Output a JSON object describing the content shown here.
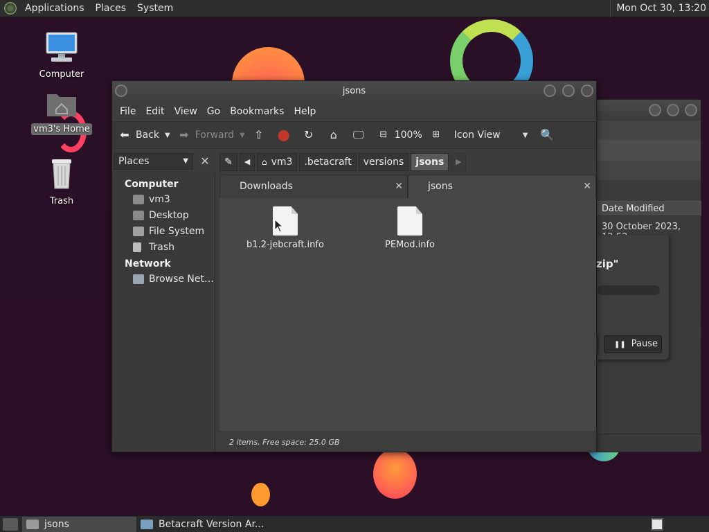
{
  "top_panel": {
    "menus": [
      "Applications",
      "Places",
      "System"
    ],
    "clock": "Mon Oct 30, 13:20"
  },
  "desktop": {
    "icons": [
      {
        "label": "Computer"
      },
      {
        "label": "vm3's Home"
      },
      {
        "label": "Trash"
      }
    ]
  },
  "window": {
    "title": "jsons",
    "menu": [
      "File",
      "Edit",
      "View",
      "Go",
      "Bookmarks",
      "Help"
    ],
    "toolbar": {
      "back": "Back",
      "forward": "Forward",
      "zoom": "100%",
      "view_mode": "Icon View"
    },
    "sidebar": {
      "selector": "Places",
      "sections": [
        {
          "title": "Computer",
          "items": [
            "vm3",
            "Desktop",
            "File System",
            "Trash"
          ]
        },
        {
          "title": "Network",
          "items": [
            "Browse Net…"
          ]
        }
      ]
    },
    "path": [
      "vm3",
      ".betacraft",
      "versions",
      "jsons"
    ],
    "tabs": [
      "Downloads",
      "jsons"
    ],
    "files": [
      "b1.2-jebcraft.info",
      "PEMod.info"
    ],
    "status": "2 items, Free space: 25.0 GB"
  },
  "bg_window": {
    "column_header": "Date Modified",
    "date": "30 October 2023, 12:52",
    "zip_text": "zip\"",
    "pause_label": "Pause"
  },
  "taskbar": {
    "tasks": [
      "jsons",
      "Betacraft Version Ar..."
    ]
  }
}
